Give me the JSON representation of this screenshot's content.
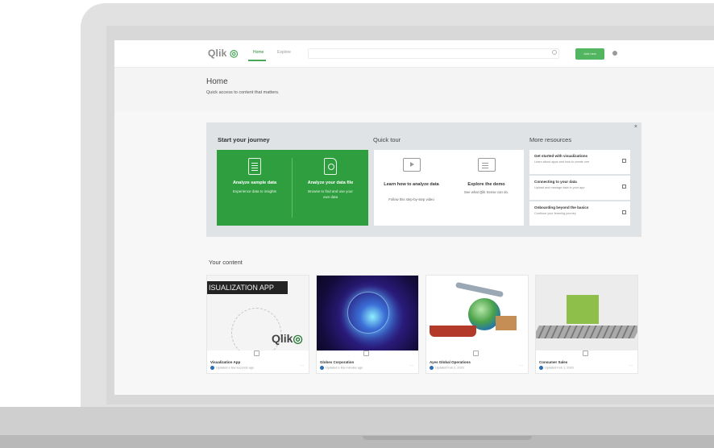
{
  "nav": {
    "logo": "Qlik",
    "home": "Home",
    "explore": "Explore",
    "add_new": "Add new",
    "icons": {
      "search": "search-icon",
      "user": "user-icon"
    }
  },
  "header": {
    "title": "Home",
    "subtitle": "Quick access to content that matters."
  },
  "journey": {
    "start_title": "Start your journey",
    "quick_tour_title": "Quick tour",
    "more_resources_title": "More resources",
    "close": "×",
    "start_cards": [
      {
        "title": "Analyze sample data",
        "desc": "Experience data to insights",
        "icon": "document-icon"
      },
      {
        "title": "Analyze your data file",
        "desc": "Browse to find and use your own data",
        "icon": "file-upload-icon"
      }
    ],
    "tour_cards": [
      {
        "title": "Learn how to analyze data",
        "desc": "Follow this step-by-step video",
        "icon": "play-video-icon"
      },
      {
        "title": "Explore the demo",
        "desc": "See what Qlik Sense can do.",
        "icon": "demo-icon"
      }
    ],
    "resources": [
      {
        "title": "Get started with visualizations",
        "desc": "Learn about apps and how to create one"
      },
      {
        "title": "Connecting to your data",
        "desc": "Upload and manage data in your app"
      },
      {
        "title": "Onboarding beyond the basics",
        "desc": "Continue your learning journey"
      }
    ]
  },
  "content": {
    "title": "Your content",
    "cards": [
      {
        "title": "Visualization App",
        "meta": "Updated a few seconds ago",
        "thumb_text": "ISUALIZATION APP",
        "thumb_brand": "Qlik"
      },
      {
        "title": "Globex Corporation",
        "meta": "Updated a few minutes ago"
      },
      {
        "title": "Ayes Global Operations",
        "meta": "Updated Feb 2, 2020"
      },
      {
        "title": "Consumer Sales",
        "meta": "Updated Feb 1, 2020"
      }
    ]
  },
  "colors": {
    "accent_green": "#2f9e3f",
    "panel_gray": "#dfe3e6"
  }
}
